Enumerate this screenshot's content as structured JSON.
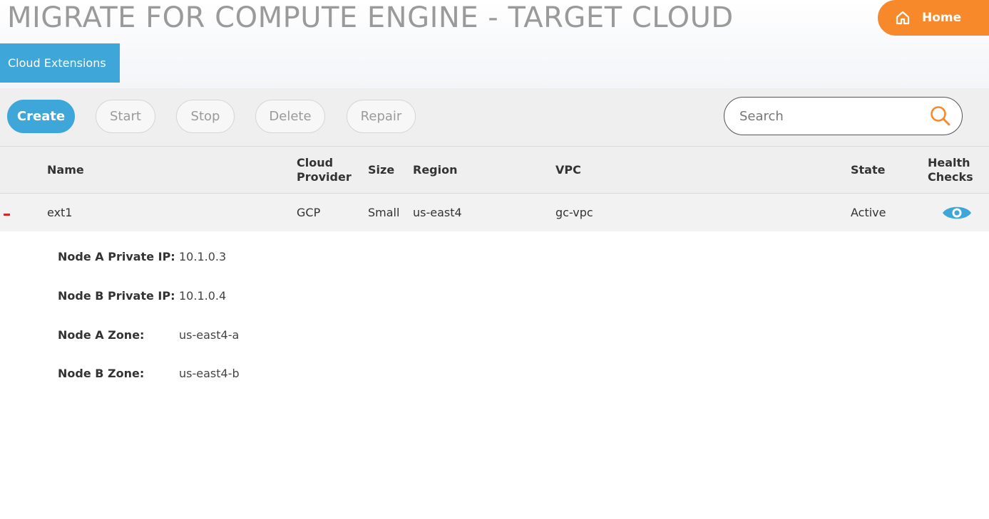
{
  "header": {
    "title": "MIGRATE FOR COMPUTE ENGINE - TARGET CLOUD",
    "home_label": "Home",
    "home_icon": "home-icon"
  },
  "tabs": [
    {
      "label": "Cloud Extensions",
      "active": true
    }
  ],
  "toolbar": {
    "create_label": "Create",
    "start_label": "Start",
    "stop_label": "Stop",
    "delete_label": "Delete",
    "repair_label": "Repair",
    "search_placeholder": "Search",
    "search_value": "",
    "search_icon": "search-icon"
  },
  "table": {
    "columns": {
      "name": "Name",
      "cloud_provider": [
        "Cloud",
        "Provider"
      ],
      "size": "Size",
      "region": "Region",
      "vpc": "VPC",
      "state": "State",
      "health_checks": [
        "Health",
        "Checks"
      ]
    },
    "rows": [
      {
        "name": "ext1",
        "cloud_provider": "GCP",
        "size": "Small",
        "region": "us-east4",
        "vpc": "gc-vpc",
        "state": "Active",
        "health_icon": "eye-icon",
        "expanded": true
      }
    ]
  },
  "details": [
    {
      "label": "Node A Private IP:",
      "value": "10.1.0.3"
    },
    {
      "label": "Node B Private IP:",
      "value": "10.1.0.4"
    },
    {
      "label": "Node A Zone:",
      "value": "us-east4-a"
    },
    {
      "label": "Node B Zone:",
      "value": "us-east4-b"
    }
  ],
  "colors": {
    "accent_blue": "#3ea6d8",
    "home_orange": "#f7892a",
    "collapse_red": "#e02424",
    "title_gray": "#9a9a9a"
  }
}
